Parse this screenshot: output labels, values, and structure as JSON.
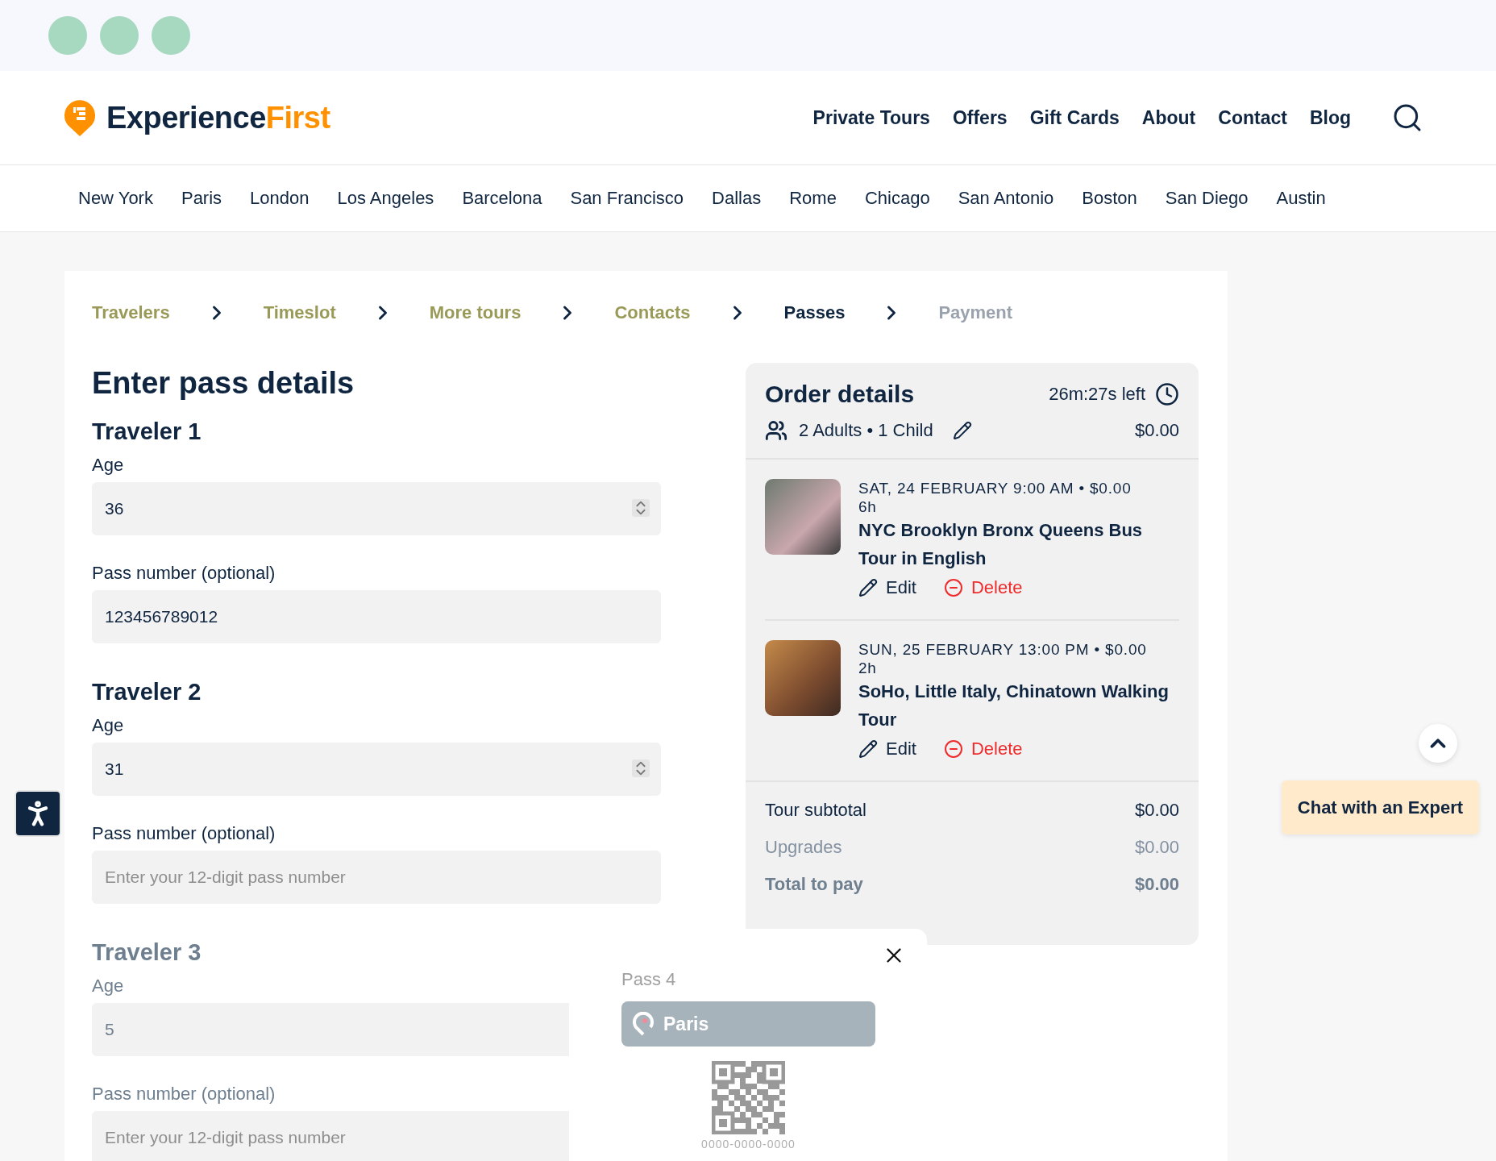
{
  "logo": {
    "name": "Experience",
    "accent": "First"
  },
  "nav": [
    "Private Tours",
    "Offers",
    "Gift Cards",
    "About",
    "Contact",
    "Blog"
  ],
  "cities": [
    "New York",
    "Paris",
    "London",
    "Los Angeles",
    "Barcelona",
    "San Francisco",
    "Dallas",
    "Rome",
    "Chicago",
    "San Antonio",
    "Boston",
    "San Diego",
    "Austin"
  ],
  "steps": [
    {
      "label": "Travelers",
      "selected": false,
      "completed": true
    },
    {
      "label": "Timeslot",
      "selected": false,
      "completed": true
    },
    {
      "label": "More tours",
      "selected": false,
      "completed": true
    },
    {
      "label": "Contacts",
      "selected": false,
      "completed": true
    },
    {
      "label": "Passes",
      "selected": true,
      "completed": false
    },
    {
      "label": "Payment",
      "selected": false,
      "completed": false
    }
  ],
  "heading": "Enter pass details",
  "travelers": [
    {
      "title": "Traveler 1",
      "age_label": "Age",
      "age": "36",
      "pass_label": "Pass number (optional)",
      "pass_value": "123456789012"
    },
    {
      "title": "Traveler 2",
      "age_label": "Age",
      "age": "31",
      "pass_label": "Pass number (optional)",
      "pass_placeholder": "Enter your 12-digit pass number"
    },
    {
      "title": "Traveler 3",
      "age_label": "Age",
      "age": "5",
      "pass_label": "Pass number (optional)",
      "pass_placeholder": "Enter your 12-digit pass number"
    }
  ],
  "order": {
    "title": "Order details",
    "timer": "26m:27s left",
    "party": "2 Adults • 1 Child",
    "party_price": "$0.00",
    "items": [
      {
        "date": "SAT, 24 FEBRUARY 9:00 AM • $0.00",
        "duration": "6h",
        "title": "NYC Brooklyn Bronx Queens Bus Tour in English",
        "edit": "Edit",
        "delete": "Delete"
      },
      {
        "date": "SUN, 25 FEBRUARY 13:00 PM • $0.00",
        "duration": "2h",
        "title": "SoHo, Little Italy, Chinatown Walking Tour",
        "edit": "Edit",
        "delete": "Delete"
      }
    ],
    "summary": [
      {
        "label": "Tour subtotal",
        "value": "$0.00",
        "kind": "subtotal"
      },
      {
        "label": "Upgrades",
        "value": "$0.00",
        "kind": "muted"
      },
      {
        "label": "Total to pay",
        "value": "$0.00",
        "kind": "total"
      }
    ]
  },
  "pass_card": {
    "title": "Pass 4",
    "city": "Paris",
    "code": "0000-0000-0000"
  },
  "chat_button": "Chat with an Expert"
}
